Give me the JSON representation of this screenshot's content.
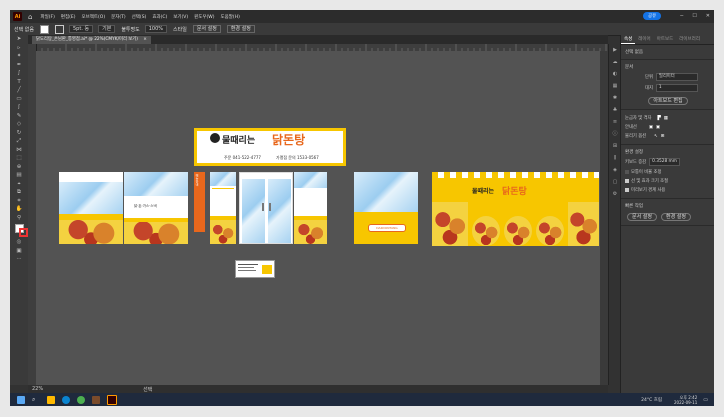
{
  "app": {
    "name": "Ai",
    "share_label": "공유"
  },
  "menu": [
    "파일(F)",
    "편집(E)",
    "오브젝트(O)",
    "문자(T)",
    "선택(S)",
    "효과(C)",
    "보기(V)",
    "윈도우(W)",
    "도움말(H)"
  ],
  "control_bar": {
    "label": "선택 없음",
    "stroke_label": "기본",
    "opacity_label": "불투명도",
    "opacity_value": "100%",
    "style_label": "스타일",
    "doc_setup": "문서 설정",
    "prefs": "환경 설정",
    "stroke_value": "5pt. 둥"
  },
  "document_tab": "닭도리탕_손님판_통영점.ai* @ 22%(CMYK/미리 보기)",
  "status": {
    "zoom": "22%",
    "mode": "선택"
  },
  "panel": {
    "tabs": [
      "속성",
      "레이어",
      "아트보드",
      "라이브러리"
    ],
    "selection": "선택 없음",
    "doc_section": "문서",
    "unit_label": "단위",
    "unit_value": "밀리미터",
    "artboard_label": "대지",
    "artboard_value": "1",
    "edit_artboard_btn": "아트보드 편집",
    "ruler_grid": "눈금자 및 격자",
    "guides": "안내선",
    "snap": "물리기 옵션",
    "prefs_section": "환경 설정",
    "keyboard_inc_label": "키보드 증감",
    "keyboard_inc_value": "0.3528 mm",
    "scale_corners": "모퉁이 비율 조정",
    "scale_strokes": "선 및 효과 크기 조절",
    "preview_bounds": "미리보기 경계 사용",
    "quick_actions": "빠른 작업",
    "doc_setup_btn": "문서 설정",
    "prefs_btn": "환경 설정"
  },
  "artwork": {
    "logo_text": "물때리는",
    "brand": "닭돈탕",
    "phone1": "주문 041-522-4777",
    "phone2": "가맹점 문의 1533-0567",
    "menu_strip": "닭·돈·가스·스낵",
    "card_label": "DAKDONTANG",
    "side_strip": "메뉴안내"
  },
  "taskbar": {
    "weather": "24°C 흐림",
    "time": "오후 2:42",
    "date": "2022-09-11"
  }
}
